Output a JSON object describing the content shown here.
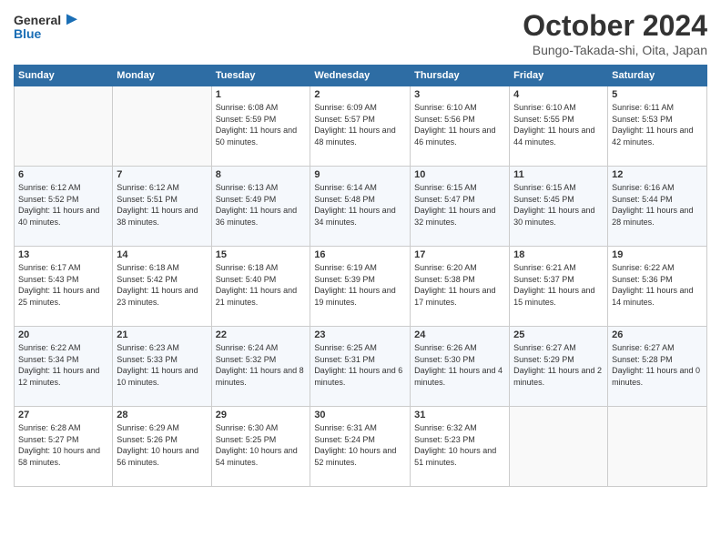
{
  "header": {
    "logo_general": "General",
    "logo_blue": "Blue",
    "month_title": "October 2024",
    "location": "Bungo-Takada-shi, Oita, Japan"
  },
  "weekdays": [
    "Sunday",
    "Monday",
    "Tuesday",
    "Wednesday",
    "Thursday",
    "Friday",
    "Saturday"
  ],
  "weeks": [
    [
      {
        "day": "",
        "info": ""
      },
      {
        "day": "",
        "info": ""
      },
      {
        "day": "1",
        "info": "Sunrise: 6:08 AM\nSunset: 5:59 PM\nDaylight: 11 hours and 50 minutes."
      },
      {
        "day": "2",
        "info": "Sunrise: 6:09 AM\nSunset: 5:57 PM\nDaylight: 11 hours and 48 minutes."
      },
      {
        "day": "3",
        "info": "Sunrise: 6:10 AM\nSunset: 5:56 PM\nDaylight: 11 hours and 46 minutes."
      },
      {
        "day": "4",
        "info": "Sunrise: 6:10 AM\nSunset: 5:55 PM\nDaylight: 11 hours and 44 minutes."
      },
      {
        "day": "5",
        "info": "Sunrise: 6:11 AM\nSunset: 5:53 PM\nDaylight: 11 hours and 42 minutes."
      }
    ],
    [
      {
        "day": "6",
        "info": "Sunrise: 6:12 AM\nSunset: 5:52 PM\nDaylight: 11 hours and 40 minutes."
      },
      {
        "day": "7",
        "info": "Sunrise: 6:12 AM\nSunset: 5:51 PM\nDaylight: 11 hours and 38 minutes."
      },
      {
        "day": "8",
        "info": "Sunrise: 6:13 AM\nSunset: 5:49 PM\nDaylight: 11 hours and 36 minutes."
      },
      {
        "day": "9",
        "info": "Sunrise: 6:14 AM\nSunset: 5:48 PM\nDaylight: 11 hours and 34 minutes."
      },
      {
        "day": "10",
        "info": "Sunrise: 6:15 AM\nSunset: 5:47 PM\nDaylight: 11 hours and 32 minutes."
      },
      {
        "day": "11",
        "info": "Sunrise: 6:15 AM\nSunset: 5:45 PM\nDaylight: 11 hours and 30 minutes."
      },
      {
        "day": "12",
        "info": "Sunrise: 6:16 AM\nSunset: 5:44 PM\nDaylight: 11 hours and 28 minutes."
      }
    ],
    [
      {
        "day": "13",
        "info": "Sunrise: 6:17 AM\nSunset: 5:43 PM\nDaylight: 11 hours and 25 minutes."
      },
      {
        "day": "14",
        "info": "Sunrise: 6:18 AM\nSunset: 5:42 PM\nDaylight: 11 hours and 23 minutes."
      },
      {
        "day": "15",
        "info": "Sunrise: 6:18 AM\nSunset: 5:40 PM\nDaylight: 11 hours and 21 minutes."
      },
      {
        "day": "16",
        "info": "Sunrise: 6:19 AM\nSunset: 5:39 PM\nDaylight: 11 hours and 19 minutes."
      },
      {
        "day": "17",
        "info": "Sunrise: 6:20 AM\nSunset: 5:38 PM\nDaylight: 11 hours and 17 minutes."
      },
      {
        "day": "18",
        "info": "Sunrise: 6:21 AM\nSunset: 5:37 PM\nDaylight: 11 hours and 15 minutes."
      },
      {
        "day": "19",
        "info": "Sunrise: 6:22 AM\nSunset: 5:36 PM\nDaylight: 11 hours and 14 minutes."
      }
    ],
    [
      {
        "day": "20",
        "info": "Sunrise: 6:22 AM\nSunset: 5:34 PM\nDaylight: 11 hours and 12 minutes."
      },
      {
        "day": "21",
        "info": "Sunrise: 6:23 AM\nSunset: 5:33 PM\nDaylight: 11 hours and 10 minutes."
      },
      {
        "day": "22",
        "info": "Sunrise: 6:24 AM\nSunset: 5:32 PM\nDaylight: 11 hours and 8 minutes."
      },
      {
        "day": "23",
        "info": "Sunrise: 6:25 AM\nSunset: 5:31 PM\nDaylight: 11 hours and 6 minutes."
      },
      {
        "day": "24",
        "info": "Sunrise: 6:26 AM\nSunset: 5:30 PM\nDaylight: 11 hours and 4 minutes."
      },
      {
        "day": "25",
        "info": "Sunrise: 6:27 AM\nSunset: 5:29 PM\nDaylight: 11 hours and 2 minutes."
      },
      {
        "day": "26",
        "info": "Sunrise: 6:27 AM\nSunset: 5:28 PM\nDaylight: 11 hours and 0 minutes."
      }
    ],
    [
      {
        "day": "27",
        "info": "Sunrise: 6:28 AM\nSunset: 5:27 PM\nDaylight: 10 hours and 58 minutes."
      },
      {
        "day": "28",
        "info": "Sunrise: 6:29 AM\nSunset: 5:26 PM\nDaylight: 10 hours and 56 minutes."
      },
      {
        "day": "29",
        "info": "Sunrise: 6:30 AM\nSunset: 5:25 PM\nDaylight: 10 hours and 54 minutes."
      },
      {
        "day": "30",
        "info": "Sunrise: 6:31 AM\nSunset: 5:24 PM\nDaylight: 10 hours and 52 minutes."
      },
      {
        "day": "31",
        "info": "Sunrise: 6:32 AM\nSunset: 5:23 PM\nDaylight: 10 hours and 51 minutes."
      },
      {
        "day": "",
        "info": ""
      },
      {
        "day": "",
        "info": ""
      }
    ]
  ]
}
